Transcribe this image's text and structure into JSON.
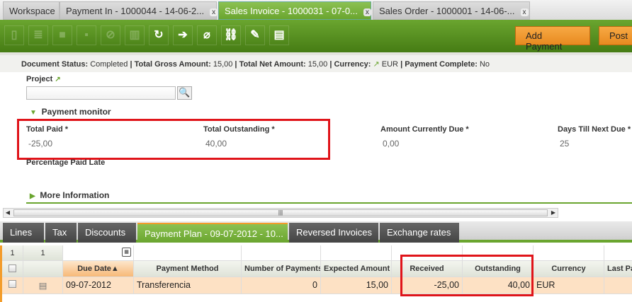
{
  "tabs": [
    {
      "label": "Workspace"
    },
    {
      "label": "Payment In - 1000044 - 14-06-2...",
      "close": "x"
    },
    {
      "label": "Sales Invoice - 1000031 - 07-0...",
      "close": "x"
    },
    {
      "label": "Sales Order - 1000001 - 14-06-...",
      "close": "x"
    }
  ],
  "toolbar": {
    "add_payment": "Add Payment",
    "post": "Post"
  },
  "status": {
    "doc_status_label": "Document Status:",
    "doc_status": "Completed",
    "gross_label": "Total Gross Amount:",
    "gross": "15,00",
    "net_label": "Total Net Amount:",
    "net": "15,00",
    "currency_label": "Currency:",
    "currency": "EUR",
    "complete_label": "Payment Complete:",
    "complete": "No",
    "sep": "|"
  },
  "form": {
    "project_label": "Project",
    "payment_monitor": "Payment monitor",
    "total_paid_label": "Total Paid *",
    "total_paid": "-25,00",
    "total_outstanding_label": "Total Outstanding *",
    "total_outstanding": "40,00",
    "amount_due_label": "Amount Currently Due *",
    "amount_due": "0,00",
    "days_label": "Days Till Next Due *",
    "days": "25",
    "pct_late_label": "Percentage Paid Late",
    "more_info": "More Information"
  },
  "bottom_tabs": [
    "Lines",
    "Tax",
    "Discounts",
    "Payment Plan - 09-07-2012 - 10...",
    "Reversed Invoices",
    "Exchange rates"
  ],
  "grid": {
    "counter1": "1",
    "counter2": "1",
    "headers": [
      "Due Date",
      "Payment Method",
      "Number of Payments",
      "Expected Amount",
      "Received",
      "Outstanding",
      "Currency",
      "Last Pa"
    ],
    "sort_indicator": "▲",
    "row": [
      "09-07-2012",
      "Transferencia",
      "0",
      "15,00",
      "-25,00",
      "40,00",
      "EUR",
      ""
    ]
  }
}
